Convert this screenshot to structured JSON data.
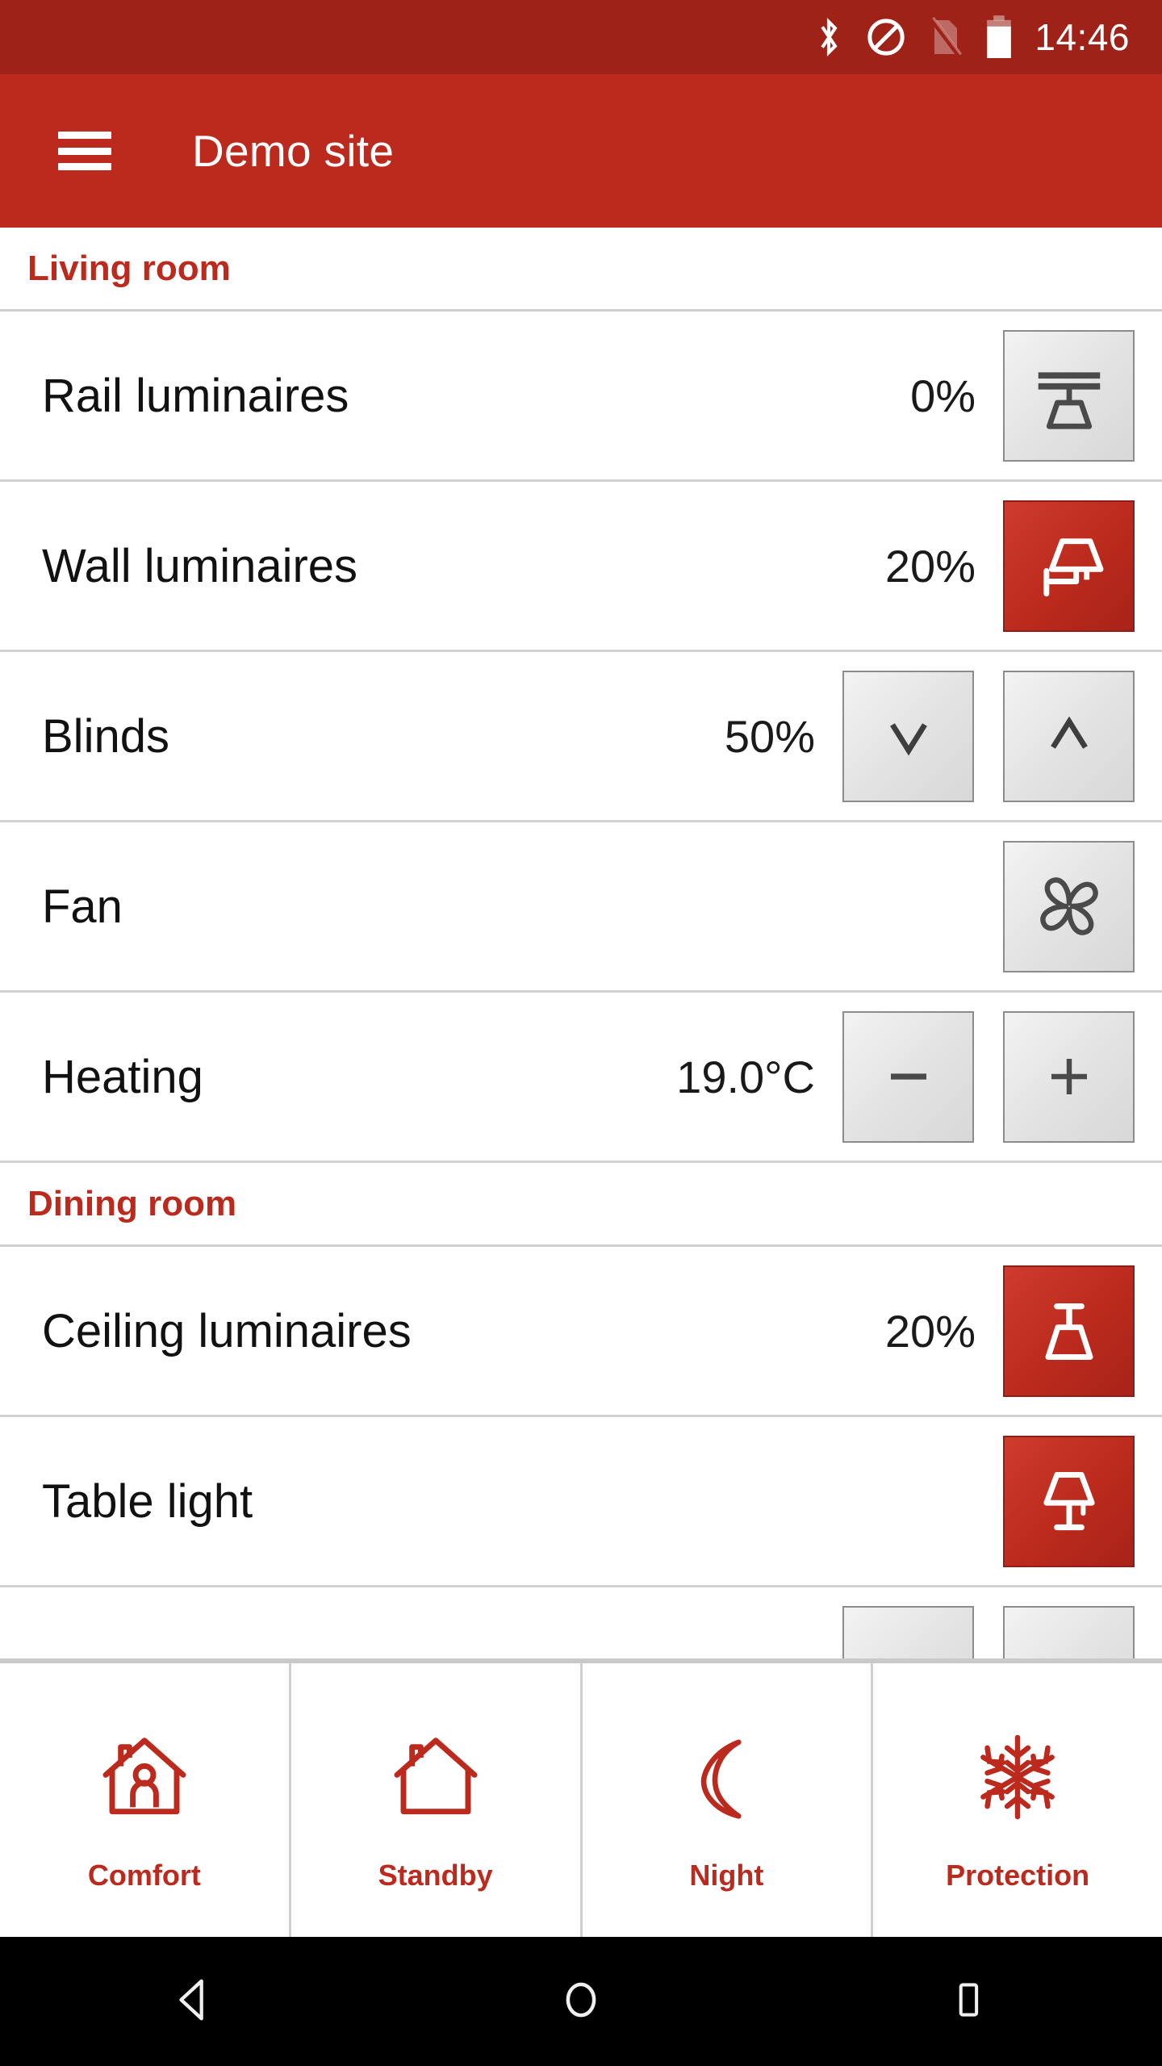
{
  "status_bar": {
    "time": "14:46",
    "icons": [
      "bluetooth-icon",
      "do-not-disturb-icon",
      "no-sim-icon",
      "battery-icon"
    ],
    "background_color": "#9e2218"
  },
  "app_bar": {
    "menu_icon": "hamburger-menu-icon",
    "title": "Demo site",
    "background_color": "#bc2a1e"
  },
  "theme": {
    "accent": "#bc2a1e",
    "accent_dark": "#9e2218",
    "button_inactive": "#e8e8e8",
    "button_active": "#bb2a1d"
  },
  "sections": [
    {
      "title": "Living room",
      "rows": [
        {
          "label": "Rail luminaires",
          "value": "0%",
          "controls": [
            {
              "icon": "rail-luminaire-icon",
              "active": false
            }
          ]
        },
        {
          "label": "Wall luminaires",
          "value": "20%",
          "controls": [
            {
              "icon": "wall-luminaire-icon",
              "active": true
            }
          ]
        },
        {
          "label": "Blinds",
          "value": "50%",
          "controls": [
            {
              "icon": "chevron-down-icon",
              "active": false
            },
            {
              "icon": "chevron-up-icon",
              "active": false
            }
          ]
        },
        {
          "label": "Fan",
          "value": "",
          "controls": [
            {
              "icon": "fan-icon",
              "active": false
            }
          ]
        },
        {
          "label": "Heating",
          "value": "19.0°C",
          "controls": [
            {
              "icon": "minus-icon",
              "active": false
            },
            {
              "icon": "plus-icon",
              "active": false
            }
          ]
        }
      ]
    },
    {
      "title": "Dining room",
      "rows": [
        {
          "label": "Ceiling luminaires",
          "value": "20%",
          "controls": [
            {
              "icon": "ceiling-luminaire-icon",
              "active": true
            }
          ]
        },
        {
          "label": "Table light",
          "value": "",
          "controls": [
            {
              "icon": "table-light-icon",
              "active": true
            }
          ]
        }
      ]
    }
  ],
  "mode_bar": {
    "buttons": [
      {
        "label": "Comfort",
        "icon": "house-with-person-icon"
      },
      {
        "label": "Standby",
        "icon": "house-icon"
      },
      {
        "label": "Night",
        "icon": "crescent-moon-icon"
      },
      {
        "label": "Protection",
        "icon": "snowflake-icon"
      }
    ]
  },
  "nav_bar": {
    "buttons": [
      {
        "name": "back-button",
        "icon": "back-triangle-icon"
      },
      {
        "name": "home-button",
        "icon": "home-circle-icon"
      },
      {
        "name": "recents-button",
        "icon": "recents-square-icon"
      }
    ]
  }
}
